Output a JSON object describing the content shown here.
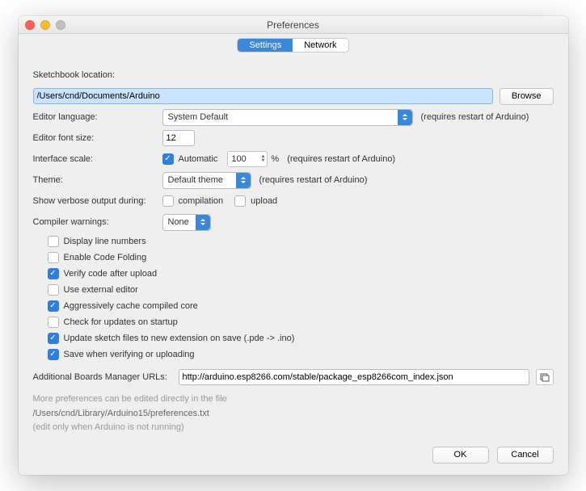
{
  "title": "Preferences",
  "tabs": {
    "settings": "Settings",
    "network": "Network"
  },
  "labels": {
    "sketchbook": "Sketchbook location:",
    "editor_lang": "Editor language:",
    "editor_font": "Editor font size:",
    "iface_scale": "Interface scale:",
    "theme": "Theme:",
    "verbose": "Show verbose output during:",
    "warnings": "Compiler warnings:",
    "addl_urls": "Additional Boards Manager URLs:"
  },
  "values": {
    "sketchbook_path": "/Users/cnd/Documents/Arduino",
    "language": "System Default",
    "font_size": "12",
    "scale_auto_label": "Automatic",
    "scale_value": "100",
    "scale_percent": "%",
    "theme": "Default theme",
    "warnings": "None",
    "addl_url": "http://arduino.esp8266.com/stable/package_esp8266com_index.json"
  },
  "hints": {
    "restart": "(requires restart of Arduino)"
  },
  "verbose": {
    "compilation": "compilation",
    "upload": "upload"
  },
  "checks": {
    "display_line_numbers": "Display line numbers",
    "enable_code_folding": "Enable Code Folding",
    "verify_after_upload": "Verify code after upload",
    "use_external_editor": "Use external editor",
    "aggressive_cache": "Aggressively cache compiled core",
    "check_updates": "Check for updates on startup",
    "update_ext": "Update sketch files to new extension on save (.pde -> .ino)",
    "save_on_verify": "Save when verifying or uploading"
  },
  "footer": {
    "line1": "More preferences can be edited directly in the file",
    "path": "/Users/cnd/Library/Arduino15/preferences.txt",
    "line3": "(edit only when Arduino is not running)"
  },
  "buttons": {
    "browse": "Browse",
    "ok": "OK",
    "cancel": "Cancel"
  }
}
